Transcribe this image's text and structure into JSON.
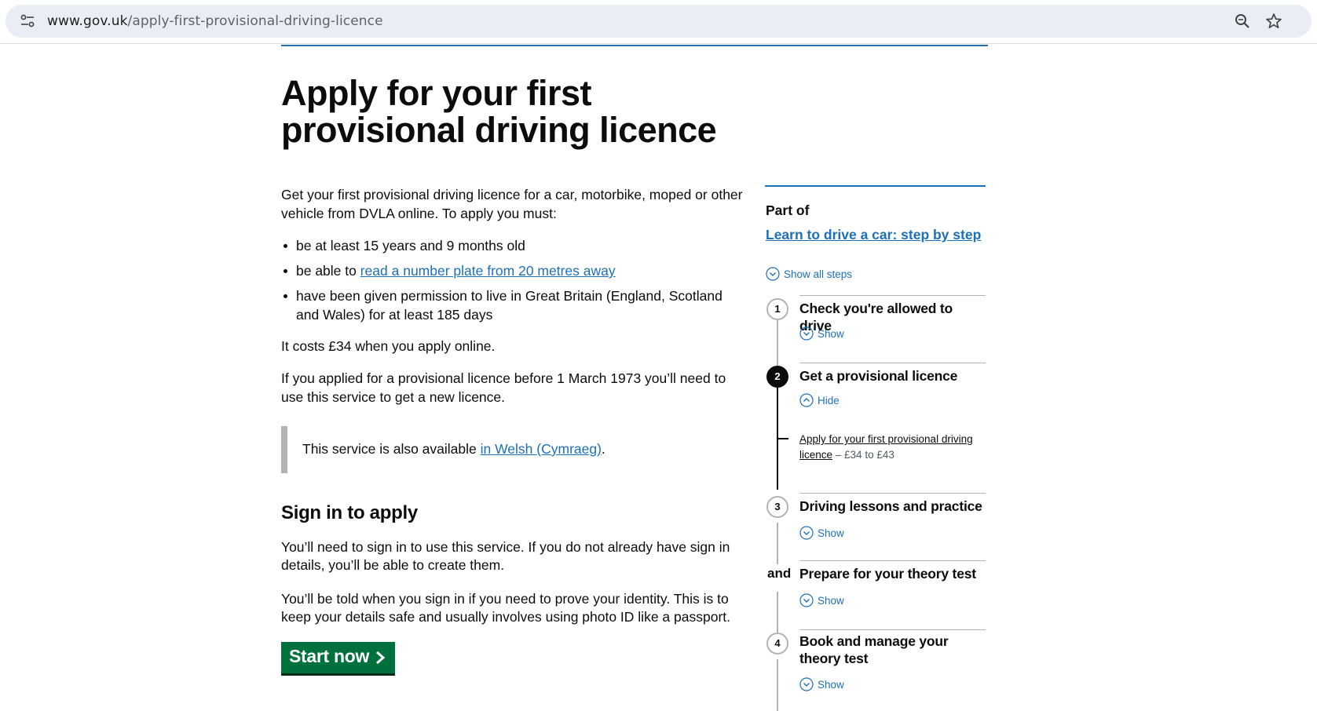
{
  "browser": {
    "url_domain": "www.gov.uk",
    "url_path": "/apply-first-provisional-driving-licence"
  },
  "page": {
    "title": "Apply for your first provisional driving licence",
    "intro": "Get your first provisional driving licence for a car, motorbike, moped or other vehicle from DVLA online. To apply you must:",
    "bullets": {
      "b1": "be at least 15 years and 9 months old",
      "b2_prefix": "be able to ",
      "b2_link": "read a number plate from 20 metres away",
      "b3": "have been given permission to live in Great Britain (England, Scotland and Wales) for at least 185 days"
    },
    "cost": "It costs £34 when you apply online.",
    "pre1973": "If you applied for a provisional licence before 1 March 1973 you’ll need to use this service to get a new licence.",
    "inset_prefix": "This service is also available ",
    "inset_link": "in Welsh (Cymraeg)",
    "inset_suffix": ".",
    "signin_heading": "Sign in to apply",
    "signin_p1": "You’ll need to sign in to use this service. If you do not already have sign in details, you’ll be able to create them.",
    "signin_p2": "You’ll be told when you sign in if you need to prove your identity. This is to keep your details safe and usually involves using photo ID like a passport.",
    "start_button": "Start now"
  },
  "sidebar": {
    "part_of": "Part of",
    "part_link": "Learn to drive a car: step by step",
    "show_all": "Show all steps",
    "steps": [
      {
        "number": "1",
        "title": "Check you're allowed to drive",
        "toggle": "Show"
      },
      {
        "number": "2",
        "title": "Get a provisional licence",
        "toggle": "Hide",
        "sub_link": "Apply for your first provisional driving licence",
        "sub_meta": " – £34 to £43"
      },
      {
        "number": "3",
        "title": "Driving lessons and practice",
        "toggle": "Show"
      },
      {
        "number": "and",
        "title": "Prepare for your theory test",
        "toggle": "Show"
      },
      {
        "number": "4",
        "title": "Book and manage your theory test",
        "toggle": "Show"
      }
    ]
  },
  "colors": {
    "link": "#1d70b8",
    "button": "#00703c",
    "text": "#0b0c0c",
    "border_grey": "#b1b4b6"
  }
}
